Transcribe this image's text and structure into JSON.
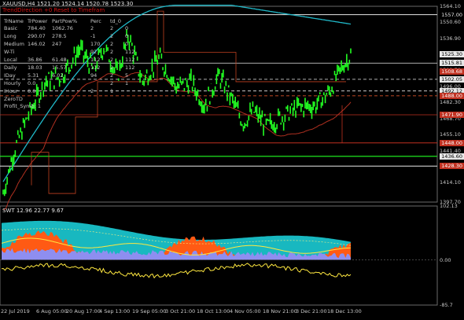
{
  "header": {
    "symbol_line": "XAUUSD,H4  1521.20 1524.14 1520.78 1523.30",
    "sub_line": "TrendDirection +0  Reset to Timefram"
  },
  "table": {
    "columns": [
      "TrName",
      "TrPower",
      "PartPow",
      "%",
      "Perc",
      "td_0"
    ],
    "rows": [
      [
        "Basic",
        "784.40",
        "1062.76",
        "",
        "2",
        "2",
        "0"
      ],
      [
        "Long",
        "290.07",
        "278.5",
        "",
        "-1",
        "2",
        "0"
      ],
      [
        "Medium",
        "146.02",
        "247",
        "",
        "170",
        "2",
        "0"
      ],
      [
        "W-Ti",
        "",
        "",
        "",
        "92",
        "2",
        "112"
      ],
      [
        "Local",
        "36.86",
        "61.48",
        "",
        "112",
        "2",
        "112"
      ],
      [
        "Daily",
        "18.03",
        "15.57",
        "",
        "112",
        "2",
        "112"
      ],
      [
        "IDay",
        "5.31",
        "6.02",
        "",
        "94",
        "2",
        "5"
      ],
      [
        "Hourly",
        "0.0",
        "",
        "",
        "",
        "2",
        "1"
      ],
      [
        "IHour",
        "0.0",
        "",
        "",
        "2",
        "1",
        ""
      ]
    ],
    "extra": [
      "ZeroTD",
      "Profit_Symb: 1"
    ]
  },
  "price_scale": [
    "1564.10",
    "1550.60",
    "1536.90",
    "1523.30",
    "1509.70",
    "1496.00",
    "1482.30",
    "1468.70",
    "1455.10",
    "1441.40",
    "1427.80",
    "1414.10",
    "1397.70"
  ],
  "price_tags": [
    {
      "text": "1557.00",
      "color": "#e8e8e8",
      "bg": "#000000",
      "value": 1557.0
    },
    {
      "text": "1525.30",
      "color": "#000000",
      "bg": "#e8e8e8",
      "value": 1523.3
    },
    {
      "text": "1515.81",
      "color": "#000000",
      "bg": "#e8e8e8",
      "value": 1515.81
    },
    {
      "text": "1508.68",
      "color": "#ffffff",
      "bg": "#c03020",
      "value": 1508.68
    },
    {
      "text": "1502.05",
      "color": "#000000",
      "bg": "#e8e8e8",
      "value": 1502.05
    },
    {
      "text": "1492.12",
      "color": "#000000",
      "bg": "#e8e8e8",
      "value": 1492.12
    },
    {
      "text": "1488.00",
      "color": "#ffffff",
      "bg": "#c03020",
      "value": 1488.0
    },
    {
      "text": "1471.90",
      "color": "#ffffff",
      "bg": "#c03020",
      "value": 1471.9
    },
    {
      "text": "1448.00",
      "color": "#ffffff",
      "bg": "#c03020",
      "value": 1448.0
    },
    {
      "text": "1436.60",
      "color": "#000000",
      "bg": "#e8e8e8",
      "value": 1436.6
    },
    {
      "text": "1428.30",
      "color": "#ffffff",
      "bg": "#c03020",
      "value": 1428.3
    }
  ],
  "indicator": {
    "label": "SWT 12.96 22.77 9.67",
    "scale": [
      "102.13",
      "0.00",
      "-85.7"
    ]
  },
  "time_axis": [
    "22 Jul 2019",
    "6 Aug 05:00",
    "20 Aug 17:00",
    "4 Sep 13:00",
    "19 Sep 05:00",
    "3 Oct 21:00",
    "18 Oct 13:00",
    "4 Nov 05:00",
    "18 Nov 21:00",
    "3 Dec 21:00",
    "18 Dec 13:00"
  ],
  "colors": {
    "candles": "#22ff22",
    "ma_teal": "#20b8c8",
    "ma_red": "#b03020",
    "support": "#22ff22",
    "fill_orange": "#ff5a14",
    "fill_cyan": "#18b8c0",
    "fill_purple": "#8e8ef0",
    "line_yellow": "#ffe840"
  }
}
